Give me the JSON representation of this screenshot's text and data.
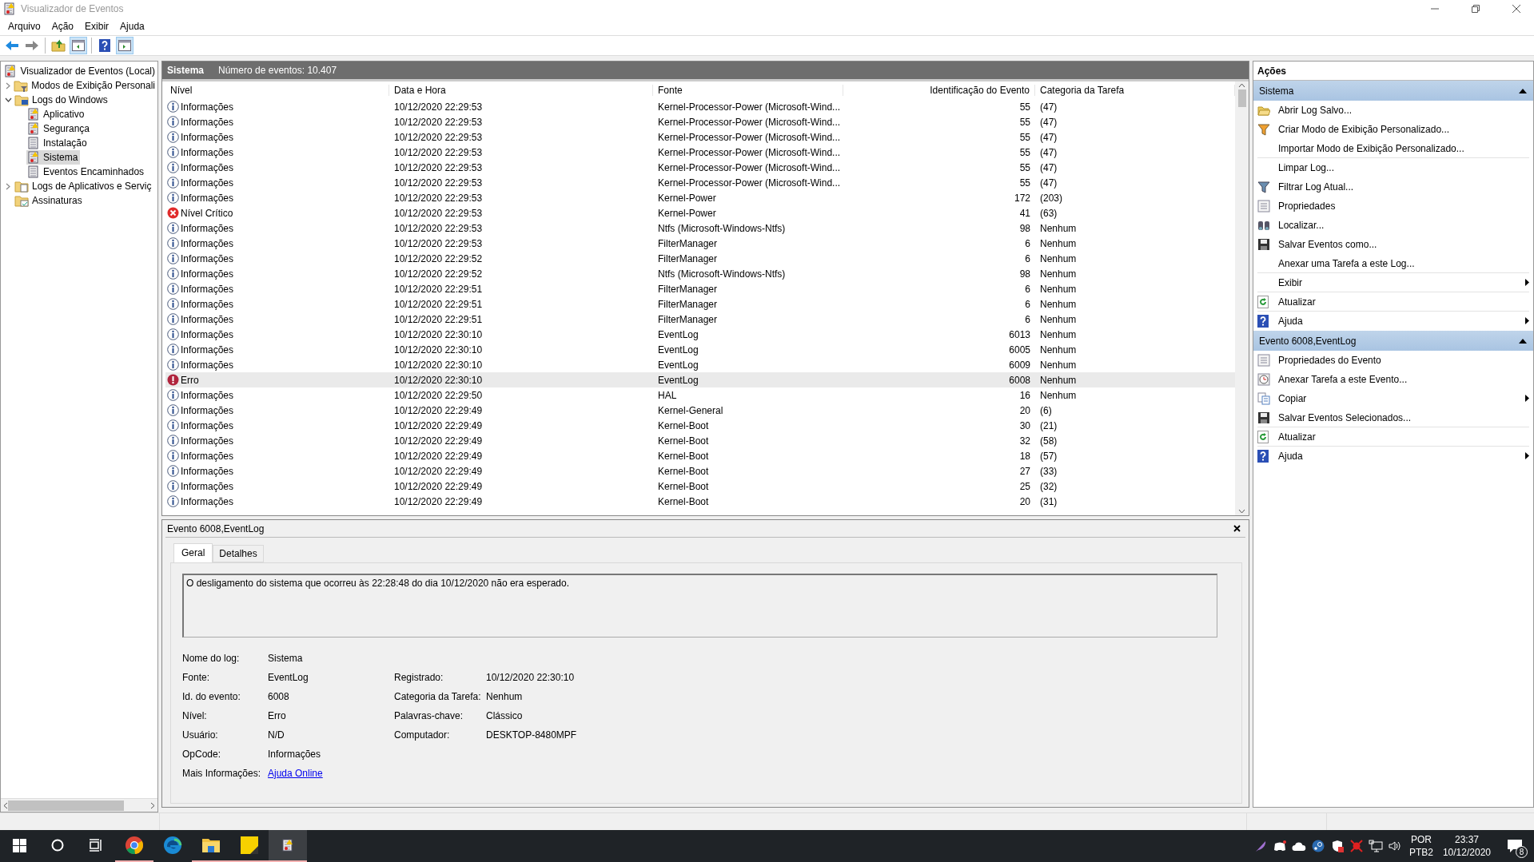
{
  "window": {
    "title": "Visualizador de Eventos"
  },
  "menu": [
    "Arquivo",
    "Ação",
    "Exibir",
    "Ajuda"
  ],
  "toolbar": [
    {
      "kind": "back"
    },
    {
      "kind": "forward"
    },
    {
      "kind": "sep"
    },
    {
      "kind": "up"
    },
    {
      "kind": "tree",
      "selected": true
    },
    {
      "kind": "sep"
    },
    {
      "kind": "help"
    },
    {
      "kind": "actions",
      "selected": true
    }
  ],
  "tree": {
    "label": "Visualizador de Eventos (Local)",
    "kind": "log",
    "children": [
      {
        "label": "Modos de Exibição Personali",
        "kind": "filters",
        "expanded": false
      },
      {
        "label": "Logs do Windows",
        "kind": "computer",
        "expanded": true,
        "children": [
          {
            "label": "Aplicativo",
            "kind": "log",
            "selected": false
          },
          {
            "label": "Segurança",
            "kind": "log",
            "selected": false
          },
          {
            "label": "Instalação",
            "kind": "page",
            "selected": false
          },
          {
            "label": "Sistema",
            "kind": "log",
            "selected": true
          },
          {
            "label": "Eventos Encaminhados",
            "kind": "page",
            "selected": false
          }
        ]
      },
      {
        "label": "Logs de Aplicativos e Serviç",
        "kind": "documents",
        "expanded": false
      },
      {
        "label": "Assinaturas",
        "kind": "calendar"
      }
    ]
  },
  "log_header": {
    "name": "Sistema",
    "count": "Número de eventos: 10.407"
  },
  "table": {
    "columns": [
      "Nível",
      "Data e Hora",
      "Fonte",
      "Identificação do Evento",
      "Categoria da Tarefa"
    ],
    "rows": [
      {
        "kind": "info",
        "level": "Informações",
        "date": "10/12/2020 22:29:53",
        "source": "Kernel-Processor-Power (Microsoft-Wind...",
        "id": "55",
        "category": "(47)",
        "selected": false
      },
      {
        "kind": "info",
        "level": "Informações",
        "date": "10/12/2020 22:29:53",
        "source": "Kernel-Processor-Power (Microsoft-Wind...",
        "id": "55",
        "category": "(47)",
        "selected": false
      },
      {
        "kind": "info",
        "level": "Informações",
        "date": "10/12/2020 22:29:53",
        "source": "Kernel-Processor-Power (Microsoft-Wind...",
        "id": "55",
        "category": "(47)",
        "selected": false
      },
      {
        "kind": "info",
        "level": "Informações",
        "date": "10/12/2020 22:29:53",
        "source": "Kernel-Processor-Power (Microsoft-Wind...",
        "id": "55",
        "category": "(47)",
        "selected": false
      },
      {
        "kind": "info",
        "level": "Informações",
        "date": "10/12/2020 22:29:53",
        "source": "Kernel-Processor-Power (Microsoft-Wind...",
        "id": "55",
        "category": "(47)",
        "selected": false
      },
      {
        "kind": "info",
        "level": "Informações",
        "date": "10/12/2020 22:29:53",
        "source": "Kernel-Processor-Power (Microsoft-Wind...",
        "id": "55",
        "category": "(47)",
        "selected": false
      },
      {
        "kind": "info",
        "level": "Informações",
        "date": "10/12/2020 22:29:53",
        "source": "Kernel-Power",
        "id": "172",
        "category": "(203)",
        "selected": false
      },
      {
        "kind": "critical",
        "level": "Nível Crítico",
        "date": "10/12/2020 22:29:53",
        "source": "Kernel-Power",
        "id": "41",
        "category": "(63)",
        "selected": false
      },
      {
        "kind": "info",
        "level": "Informações",
        "date": "10/12/2020 22:29:53",
        "source": "Ntfs (Microsoft-Windows-Ntfs)",
        "id": "98",
        "category": "Nenhum",
        "selected": false
      },
      {
        "kind": "info",
        "level": "Informações",
        "date": "10/12/2020 22:29:53",
        "source": "FilterManager",
        "id": "6",
        "category": "Nenhum",
        "selected": false
      },
      {
        "kind": "info",
        "level": "Informações",
        "date": "10/12/2020 22:29:52",
        "source": "FilterManager",
        "id": "6",
        "category": "Nenhum",
        "selected": false
      },
      {
        "kind": "info",
        "level": "Informações",
        "date": "10/12/2020 22:29:52",
        "source": "Ntfs (Microsoft-Windows-Ntfs)",
        "id": "98",
        "category": "Nenhum",
        "selected": false
      },
      {
        "kind": "info",
        "level": "Informações",
        "date": "10/12/2020 22:29:51",
        "source": "FilterManager",
        "id": "6",
        "category": "Nenhum",
        "selected": false
      },
      {
        "kind": "info",
        "level": "Informações",
        "date": "10/12/2020 22:29:51",
        "source": "FilterManager",
        "id": "6",
        "category": "Nenhum",
        "selected": false
      },
      {
        "kind": "info",
        "level": "Informações",
        "date": "10/12/2020 22:29:51",
        "source": "FilterManager",
        "id": "6",
        "category": "Nenhum",
        "selected": false
      },
      {
        "kind": "info",
        "level": "Informações",
        "date": "10/12/2020 22:30:10",
        "source": "EventLog",
        "id": "6013",
        "category": "Nenhum",
        "selected": false
      },
      {
        "kind": "info",
        "level": "Informações",
        "date": "10/12/2020 22:30:10",
        "source": "EventLog",
        "id": "6005",
        "category": "Nenhum",
        "selected": false
      },
      {
        "kind": "info",
        "level": "Informações",
        "date": "10/12/2020 22:30:10",
        "source": "EventLog",
        "id": "6009",
        "category": "Nenhum",
        "selected": false
      },
      {
        "kind": "error",
        "level": "Erro",
        "date": "10/12/2020 22:30:10",
        "source": "EventLog",
        "id": "6008",
        "category": "Nenhum",
        "selected": true
      },
      {
        "kind": "info",
        "level": "Informações",
        "date": "10/12/2020 22:29:50",
        "source": "HAL",
        "id": "16",
        "category": "Nenhum",
        "selected": false
      },
      {
        "kind": "info",
        "level": "Informações",
        "date": "10/12/2020 22:29:49",
        "source": "Kernel-General",
        "id": "20",
        "category": "(6)",
        "selected": false
      },
      {
        "kind": "info",
        "level": "Informações",
        "date": "10/12/2020 22:29:49",
        "source": "Kernel-Boot",
        "id": "30",
        "category": "(21)",
        "selected": false
      },
      {
        "kind": "info",
        "level": "Informações",
        "date": "10/12/2020 22:29:49",
        "source": "Kernel-Boot",
        "id": "32",
        "category": "(58)",
        "selected": false
      },
      {
        "kind": "info",
        "level": "Informações",
        "date": "10/12/2020 22:29:49",
        "source": "Kernel-Boot",
        "id": "18",
        "category": "(57)",
        "selected": false
      },
      {
        "kind": "info",
        "level": "Informações",
        "date": "10/12/2020 22:29:49",
        "source": "Kernel-Boot",
        "id": "27",
        "category": "(33)",
        "selected": false
      },
      {
        "kind": "info",
        "level": "Informações",
        "date": "10/12/2020 22:29:49",
        "source": "Kernel-Boot",
        "id": "25",
        "category": "(32)",
        "selected": false
      },
      {
        "kind": "info",
        "level": "Informações",
        "date": "10/12/2020 22:29:49",
        "source": "Kernel-Boot",
        "id": "20",
        "category": "(31)",
        "selected": false
      }
    ]
  },
  "details": {
    "title": "Evento 6008,EventLog",
    "tabs": [
      {
        "label": "Geral",
        "selected": true
      },
      {
        "label": "Detalhes",
        "selected": false
      }
    ],
    "description": "O desligamento do sistema que ocorreu às 22:28:48 do dia 10/12/2020 não era esperado.",
    "left_fields": [
      {
        "label": "Nome do log:",
        "value": "Sistema"
      },
      {
        "label": "Fonte:",
        "value": "EventLog"
      },
      {
        "label": "Id. do evento:",
        "value": "6008"
      },
      {
        "label": "Nível:",
        "value": "Erro"
      },
      {
        "label": "Usuário:",
        "value": "N/D"
      },
      {
        "label": "OpCode:",
        "value": "Informações"
      },
      {
        "label": "Mais Informações:",
        "value": "Ajuda Online",
        "kind": "link"
      }
    ],
    "right_fields": [
      {
        "label": "Registrado:",
        "value": "10/12/2020 22:30:10"
      },
      {
        "label": "Categoria da Tarefa:",
        "value": "Nenhum"
      },
      {
        "label": "Palavras-chave:",
        "value": "Clássico"
      },
      {
        "label": "Computador:",
        "value": "DESKTOP-8480MPF"
      }
    ]
  },
  "actions": {
    "title": "Ações",
    "sections": [
      {
        "title": "Sistema",
        "expanded": true,
        "items": [
          {
            "label": "Abrir Log Salvo...",
            "kind": "open"
          },
          {
            "label": "Criar Modo de Exibição Personalizado...",
            "kind": "create-view"
          },
          {
            "label": "Importar Modo de Exibição Personalizado...",
            "kind": "plain",
            "separator": true
          },
          {
            "label": "Limpar Log...",
            "kind": "plain"
          },
          {
            "label": "Filtrar Log Atual...",
            "kind": "filter"
          },
          {
            "label": "Propriedades",
            "kind": "properties"
          },
          {
            "label": "Localizar...",
            "kind": "find"
          },
          {
            "label": "Salvar Eventos como...",
            "kind": "save"
          },
          {
            "label": "Anexar uma Tarefa a este Log...",
            "kind": "plain",
            "separator": true
          },
          {
            "label": "Exibir",
            "kind": "plain",
            "submenu": true,
            "separator": true
          },
          {
            "label": "Atualizar",
            "kind": "refresh",
            "separator": true
          },
          {
            "label": "Ajuda",
            "kind": "help",
            "submenu": true
          }
        ]
      },
      {
        "title": "Evento 6008,EventLog",
        "expanded": true,
        "items": [
          {
            "label": "Propriedades do Evento",
            "kind": "properties"
          },
          {
            "label": "Anexar Tarefa a este Evento...",
            "kind": "task"
          },
          {
            "label": "Copiar",
            "kind": "copy",
            "submenu": true
          },
          {
            "label": "Salvar Eventos Selecionados...",
            "kind": "save",
            "separator": true
          },
          {
            "label": "Atualizar",
            "kind": "refresh",
            "separator": true
          },
          {
            "label": "Ajuda",
            "kind": "help",
            "submenu": true
          }
        ]
      }
    ]
  },
  "taskbar": {
    "apps": [
      {
        "kind": "start"
      },
      {
        "kind": "search"
      },
      {
        "kind": "task-view"
      },
      {
        "kind": "browser1",
        "running": true
      },
      {
        "kind": "browser2",
        "running": false
      },
      {
        "kind": "files",
        "running": true
      },
      {
        "kind": "notes",
        "running": true
      },
      {
        "kind": "viewer",
        "running": true,
        "selected": true
      }
    ],
    "tray": [
      {
        "kind": "feather"
      },
      {
        "kind": "chat"
      },
      {
        "kind": "cloud"
      },
      {
        "kind": "game"
      },
      {
        "kind": "shield"
      },
      {
        "kind": "virus"
      },
      {
        "kind": "network"
      },
      {
        "kind": "volume"
      }
    ],
    "language": "POR",
    "layout": "PTB2",
    "time": "23:37",
    "date": "10/12/2020",
    "notifications": "8"
  }
}
